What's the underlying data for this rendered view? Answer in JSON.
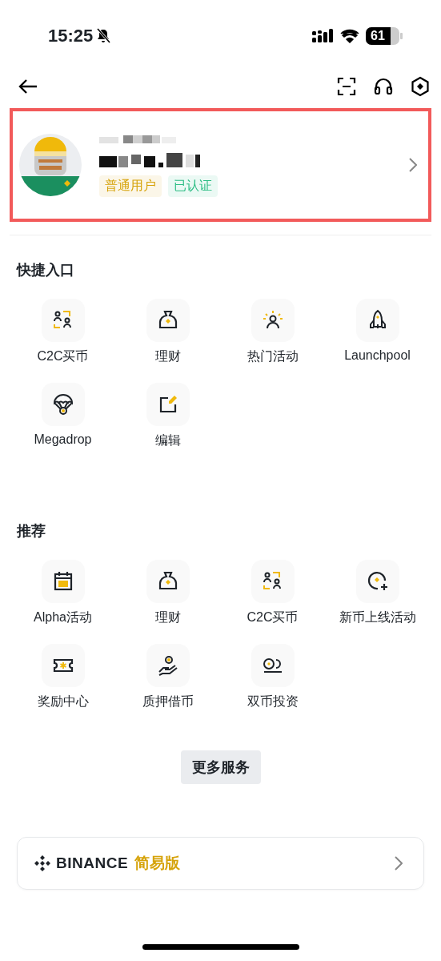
{
  "status_bar": {
    "time": "15:25",
    "battery": "61"
  },
  "profile": {
    "tags": [
      {
        "label": "普通用户",
        "color": "#d6a30a"
      },
      {
        "label": "已认证",
        "color": "#2ebd85"
      }
    ]
  },
  "sections": [
    {
      "title": "快捷入口",
      "items": [
        {
          "label": "C2C买币",
          "kind": "c2c"
        },
        {
          "label": "理财",
          "kind": "bag"
        },
        {
          "label": "热门活动",
          "kind": "star-person"
        },
        {
          "label": "Launchpool",
          "kind": "rocket"
        },
        {
          "label": "Megadrop",
          "kind": "parachute"
        },
        {
          "label": "编辑",
          "kind": "edit"
        }
      ]
    },
    {
      "title": "推荐",
      "items": [
        {
          "label": "Alpha活动",
          "kind": "calendar"
        },
        {
          "label": "理财",
          "kind": "bag"
        },
        {
          "label": "C2C买币",
          "kind": "c2c"
        },
        {
          "label": "新币上线活动",
          "kind": "coin-plus"
        },
        {
          "label": "奖励中心",
          "kind": "ticket"
        },
        {
          "label": "质押借币",
          "kind": "hand"
        },
        {
          "label": "双币投资",
          "kind": "dual"
        }
      ]
    }
  ],
  "more_button": "更多服务",
  "lite_card": {
    "brand": "BINANCE",
    "label": "简易版"
  }
}
